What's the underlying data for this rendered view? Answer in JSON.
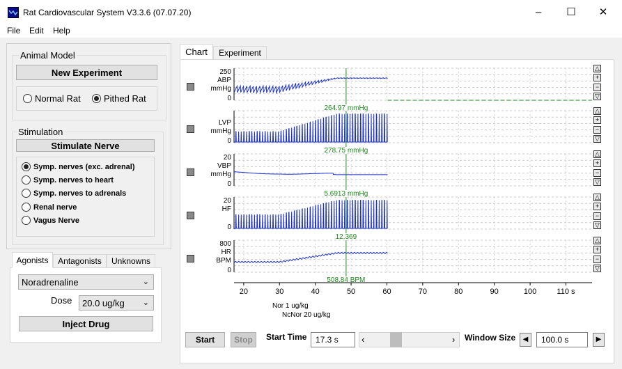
{
  "window": {
    "title": "Rat Cardiovascular System V3.3.6 (07.07.20)",
    "minimize_label": "–",
    "maximize_label": "☐",
    "close_label": "✕"
  },
  "menu": [
    "File",
    "Edit",
    "Help"
  ],
  "animal_model": {
    "group_title": "Animal Model",
    "new_experiment_label": "New Experiment",
    "options": [
      {
        "label": "Normal Rat",
        "selected": false
      },
      {
        "label": "Pithed Rat",
        "selected": true
      }
    ]
  },
  "stimulation": {
    "group_title": "Stimulation",
    "stimulate_label": "Stimulate Nerve",
    "options": [
      {
        "label": "Symp. nerves (exc. adrenal)",
        "selected": true
      },
      {
        "label": "Symp. nerves to heart",
        "selected": false
      },
      {
        "label": "Symp. nerves to adrenals",
        "selected": false
      },
      {
        "label": "Renal nerve",
        "selected": false
      },
      {
        "label": "Vagus Nerve",
        "selected": false
      }
    ]
  },
  "drug_tabs": [
    "Agonists",
    "Antagonists",
    "Unknowns"
  ],
  "drug": {
    "selected": "Noradrenaline",
    "dose_label": "Dose",
    "dose_value": "20.0 ug/kg",
    "inject_label": "Inject Drug"
  },
  "main_tabs": [
    "Chart",
    "Experiment"
  ],
  "chart_data": [
    {
      "type": "line",
      "ylabel": "ABP",
      "unit": "mmHg",
      "ytop": "250",
      "ybottom": "0",
      "readout": "264.97 mmHg"
    },
    {
      "type": "line",
      "ylabel": "LVP",
      "unit": "mmHg",
      "ytop": "",
      "ybottom": "0",
      "readout": "278.75 mmHg"
    },
    {
      "type": "line",
      "ylabel": "VBP",
      "unit": "mmHg",
      "ytop": "20",
      "ybottom": "0",
      "readout": "5.6913 mmHg"
    },
    {
      "type": "line",
      "ylabel": "HF",
      "unit": "",
      "ytop": "20",
      "ybottom": "0",
      "readout": "12.369"
    },
    {
      "type": "line",
      "ylabel": "HR",
      "unit": "BPM",
      "ytop": "800",
      "ybottom": "0",
      "readout": "508.84 BPM"
    }
  ],
  "x_axis": {
    "ticks": [
      "20",
      "30",
      "40",
      "50",
      "60",
      "70",
      "80",
      "90",
      "100",
      "110 s"
    ]
  },
  "annotations": [
    "Nor 1 ug/kg",
    "NcNor 20 ug/kg"
  ],
  "controls": {
    "start_label": "Start",
    "stop_label": "Stop",
    "start_time_label": "Start Time",
    "start_time_value": "17.3 s",
    "window_size_label": "Window Size",
    "window_size_value": "100.0 s"
  }
}
